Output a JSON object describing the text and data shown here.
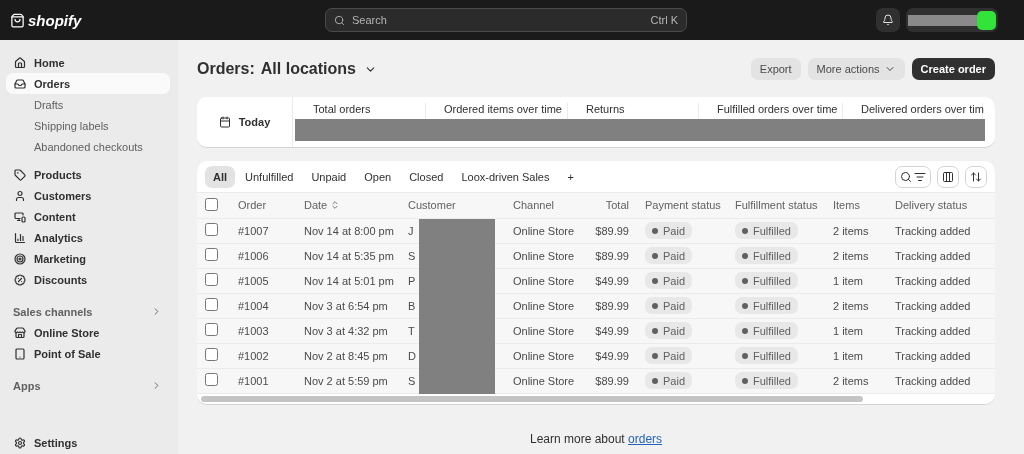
{
  "topbar": {
    "logo": "shopify",
    "search": {
      "placeholder": "Search",
      "shortcut": "Ctrl K"
    }
  },
  "sidebar": {
    "items": [
      {
        "label": "Home",
        "selected": false
      },
      {
        "label": "Orders",
        "selected": true,
        "children": [
          {
            "label": "Drafts",
            "selected": false
          },
          {
            "label": "Shipping labels",
            "selected": false
          },
          {
            "label": "Abandoned checkouts",
            "selected": false
          }
        ]
      },
      {
        "label": "Products",
        "selected": false
      },
      {
        "label": "Customers",
        "selected": false
      },
      {
        "label": "Content",
        "selected": false
      },
      {
        "label": "Analytics",
        "selected": false
      },
      {
        "label": "Marketing",
        "selected": false
      },
      {
        "label": "Discounts",
        "selected": false
      }
    ],
    "sections": [
      {
        "title": "Sales channels",
        "items": [
          {
            "label": "Online Store",
            "selected": false
          },
          {
            "label": "Point of Sale",
            "selected": false
          }
        ]
      },
      {
        "title": "Apps"
      }
    ],
    "settings": "Settings"
  },
  "page": {
    "title": "Orders:",
    "location": "All locations",
    "actions": [
      {
        "label": "Export",
        "kind": "plain"
      },
      {
        "label": "More actions",
        "kind": "menu"
      },
      {
        "label": "Create order",
        "kind": "primary"
      }
    ]
  },
  "stats": {
    "range": "Today",
    "metrics": [
      "Total orders",
      "Ordered items over time",
      "Returns",
      "Fulfilled orders over time",
      "Delivered orders over tim"
    ]
  },
  "tabs": [
    {
      "label": "All",
      "selected": true
    },
    {
      "label": "Unfulfilled",
      "selected": false
    },
    {
      "label": "Unpaid",
      "selected": false
    },
    {
      "label": "Open",
      "selected": false
    },
    {
      "label": "Closed",
      "selected": false
    },
    {
      "label": "Loox-driven Sales",
      "selected": false
    }
  ],
  "add_tab": "+",
  "table": {
    "select_all": {
      "checked": false
    },
    "columns": [
      "Order",
      "Date",
      "Customer",
      "Channel",
      "Total",
      "Payment status",
      "Fulfillment status",
      "Items",
      "Delivery status"
    ],
    "rows": [
      {
        "checked": false,
        "order": "#1007",
        "date": "Nov 14 at 8:00 pm",
        "customer": "J",
        "channel": "Online Store",
        "total": "$89.99",
        "payment": "Paid",
        "fulfillment": "Fulfilled",
        "items": "2 items",
        "delivery": "Tracking added"
      },
      {
        "checked": false,
        "order": "#1006",
        "date": "Nov 14 at 5:35 pm",
        "customer": "S",
        "channel": "Online Store",
        "total": "$89.99",
        "payment": "Paid",
        "fulfillment": "Fulfilled",
        "items": "2 items",
        "delivery": "Tracking added"
      },
      {
        "checked": false,
        "order": "#1005",
        "date": "Nov 14 at 5:01 pm",
        "customer": "P",
        "channel": "Online Store",
        "total": "$49.99",
        "payment": "Paid",
        "fulfillment": "Fulfilled",
        "items": "1 item",
        "delivery": "Tracking added"
      },
      {
        "checked": false,
        "order": "#1004",
        "date": "Nov 3 at 6:54 pm",
        "customer": "B",
        "channel": "Online Store",
        "total": "$89.99",
        "payment": "Paid",
        "fulfillment": "Fulfilled",
        "items": "2 items",
        "delivery": "Tracking added"
      },
      {
        "checked": false,
        "order": "#1003",
        "date": "Nov 3 at 4:32 pm",
        "customer": "T",
        "channel": "Online Store",
        "total": "$49.99",
        "payment": "Paid",
        "fulfillment": "Fulfilled",
        "items": "1 item",
        "delivery": "Tracking added"
      },
      {
        "checked": false,
        "order": "#1002",
        "date": "Nov 2 at 8:45 pm",
        "customer": "D",
        "channel": "Online Store",
        "total": "$49.99",
        "payment": "Paid",
        "fulfillment": "Fulfilled",
        "items": "1 item",
        "delivery": "Tracking added"
      },
      {
        "checked": false,
        "order": "#1001",
        "date": "Nov 2 at 5:59 pm",
        "customer": "S",
        "channel": "Online Store",
        "total": "$89.99",
        "payment": "Paid",
        "fulfillment": "Fulfilled",
        "items": "2 items",
        "delivery": "Tracking added"
      }
    ]
  },
  "footer": {
    "text": "Learn more about",
    "link": "orders"
  }
}
